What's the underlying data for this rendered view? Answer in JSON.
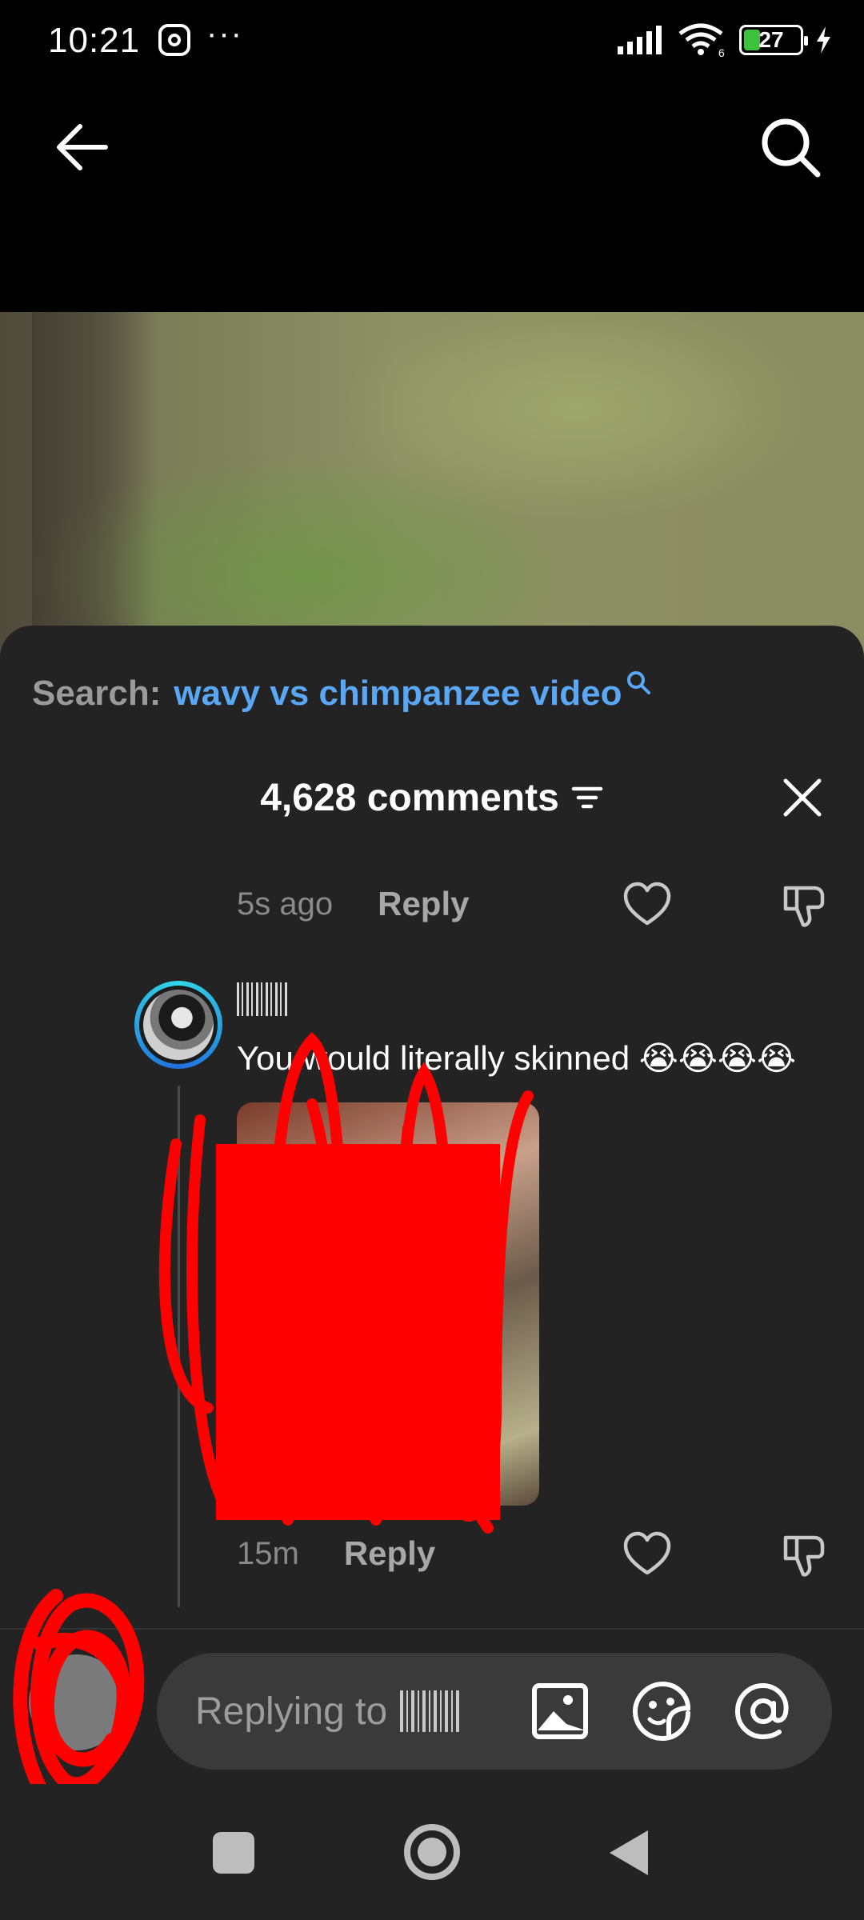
{
  "status_bar": {
    "time": "10:21",
    "more": "···",
    "network_label": "6",
    "battery": "27",
    "icons": [
      "instagram-icon",
      "signal-icon",
      "wifi-icon",
      "battery-icon",
      "charging-icon"
    ]
  },
  "top_nav": {
    "icons": [
      "back-arrow-icon",
      "search-icon"
    ]
  },
  "sheet": {
    "search_prefix": "Search:",
    "search_query": "wavy vs chimpanzee video",
    "comments_count": "4,628 comments",
    "icons": [
      "sort-icon",
      "close-icon"
    ]
  },
  "comments": [
    {
      "time": "5s ago",
      "reply_label": "Reply"
    },
    {
      "text": "You would literally skinned 😭😭😭😭",
      "time": "15m",
      "reply_label": "Reply",
      "has_image": true
    }
  ],
  "reply_bar": {
    "placeholder": "Replying to",
    "icons": [
      "image-icon",
      "sticker-icon",
      "mention-icon"
    ]
  },
  "colors": {
    "accent_link": "#5aa8f5",
    "sheet_bg": "#232323",
    "scribble": "#ff0000"
  },
  "android_nav": {
    "icons": [
      "recents-icon",
      "home-icon",
      "nav-back-icon"
    ]
  }
}
